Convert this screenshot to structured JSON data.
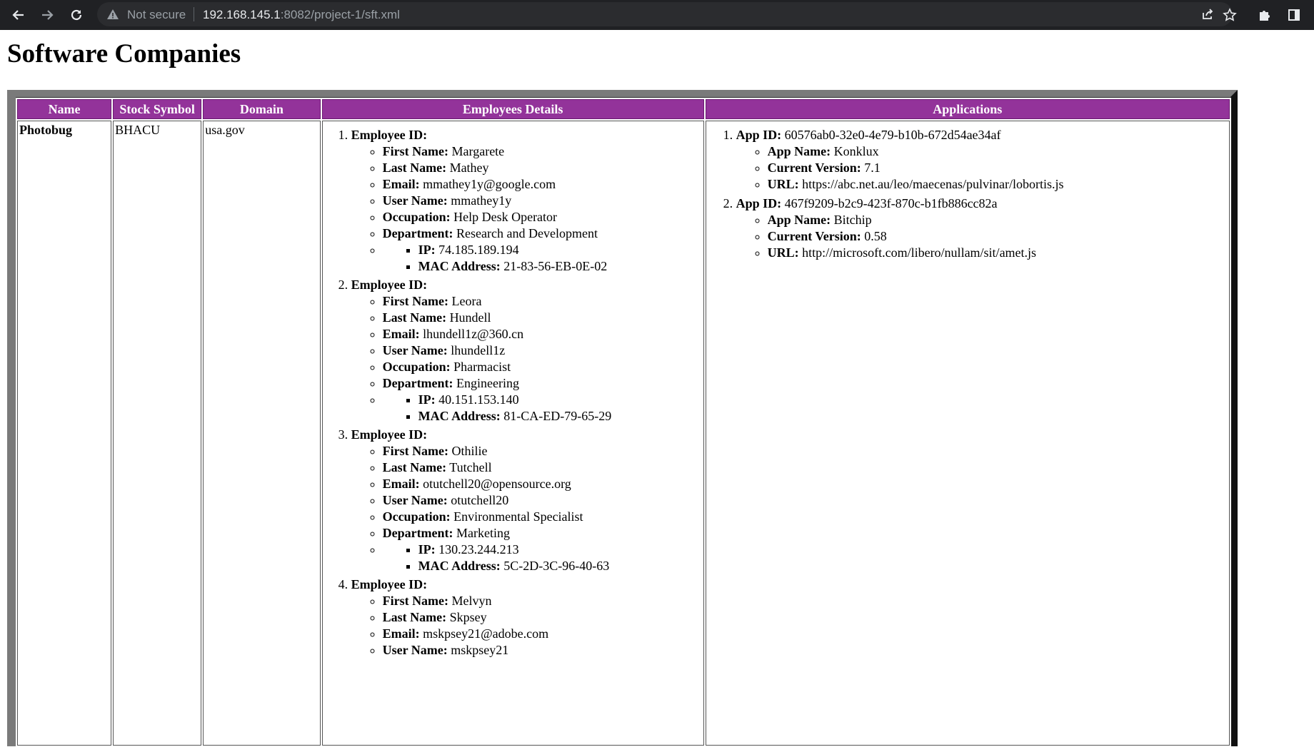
{
  "browser": {
    "not_secure": "Not secure",
    "url_host": "192.168.145.1",
    "url_rest": ":8082/project-1/sft.xml"
  },
  "page": {
    "title": "Software Companies"
  },
  "table": {
    "headers": [
      "Name",
      "Stock Symbol",
      "Domain",
      "Employees Details",
      "Applications"
    ],
    "row": {
      "name": "Photobug",
      "stock_symbol": "BHACU",
      "domain": "usa.gov"
    }
  },
  "labels": {
    "employee_id": "Employee ID:",
    "first_name": "First Name:",
    "last_name": "Last Name:",
    "email": "Email:",
    "user_name": "User Name:",
    "occupation": "Occupation:",
    "department": "Department:",
    "ip": "IP:",
    "mac": "MAC Address:",
    "app_id": "App ID:",
    "app_name": "App Name:",
    "current_version": "Current Version:",
    "url": "URL:"
  },
  "employees": [
    {
      "first_name": "Margarete",
      "last_name": "Mathey",
      "email": "mmathey1y@google.com",
      "user_name": "mmathey1y",
      "occupation": "Help Desk Operator",
      "department": "Research and Development",
      "ip": "74.185.189.194",
      "mac": "21-83-56-EB-0E-02"
    },
    {
      "first_name": "Leora",
      "last_name": "Hundell",
      "email": "lhundell1z@360.cn",
      "user_name": "lhundell1z",
      "occupation": "Pharmacist",
      "department": "Engineering",
      "ip": "40.151.153.140",
      "mac": "81-CA-ED-79-65-29"
    },
    {
      "first_name": "Othilie",
      "last_name": "Tutchell",
      "email": "otutchell20@opensource.org",
      "user_name": "otutchell20",
      "occupation": "Environmental Specialist",
      "department": "Marketing",
      "ip": "130.23.244.213",
      "mac": "5C-2D-3C-96-40-63"
    },
    {
      "first_name": "Melvyn",
      "last_name": "Skpsey",
      "email": "mskpsey21@adobe.com",
      "user_name": "mskpsey21"
    }
  ],
  "applications": [
    {
      "app_id": "60576ab0-32e0-4e79-b10b-672d54ae34af",
      "app_name": "Konklux",
      "current_version": "7.1",
      "url": "https://abc.net.au/leo/maecenas/pulvinar/lobortis.js"
    },
    {
      "app_id": "467f9209-b2c9-423f-870c-b1fb886cc82a",
      "app_name": "Bitchip",
      "current_version": "0.58",
      "url": "http://microsoft.com/libero/nullam/sit/amet.js"
    }
  ]
}
